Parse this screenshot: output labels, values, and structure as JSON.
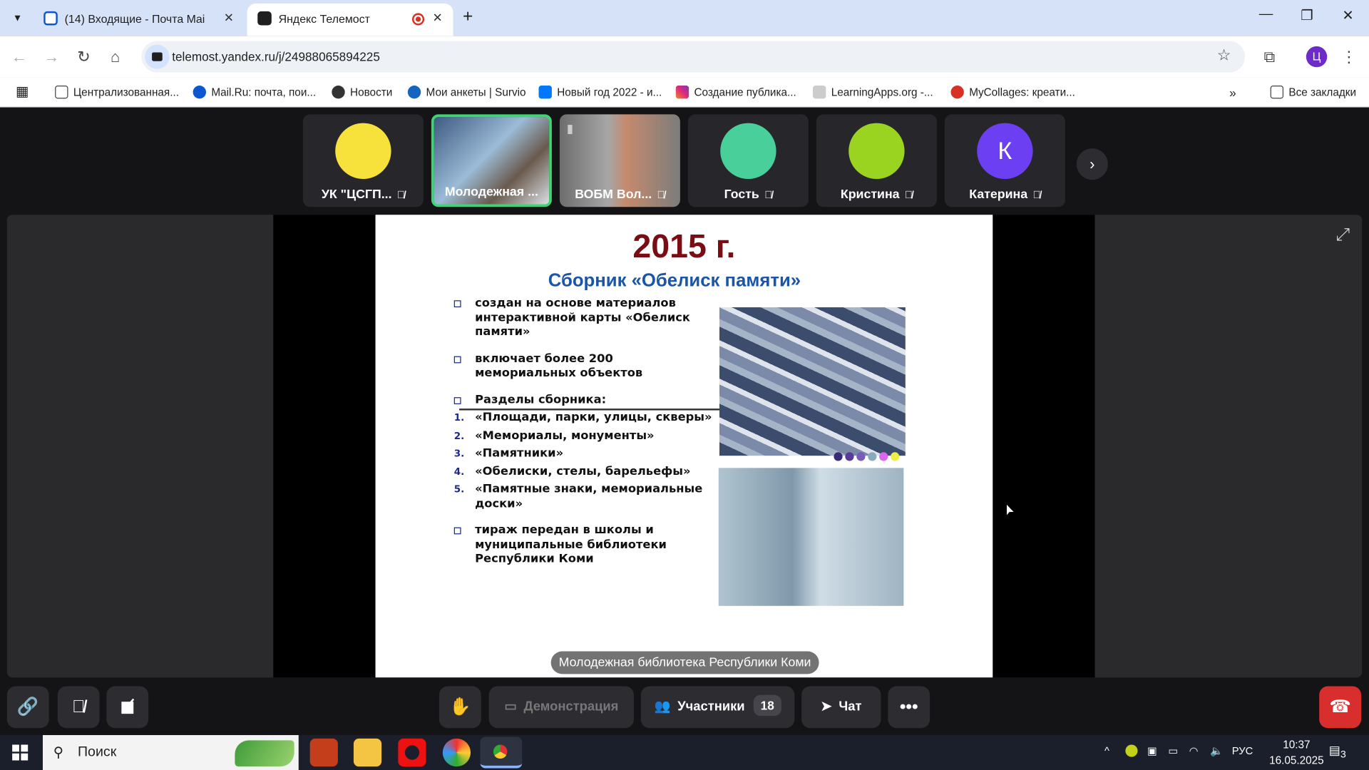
{
  "browser": {
    "tabs": [
      {
        "title": "(14) Входящие - Почта Mail",
        "icon": "mail-icon"
      },
      {
        "title": "Яндекс Телемост",
        "icon": "telemost-icon",
        "recording": true
      }
    ],
    "url": "telemost.yandex.ru/j/24988065894225",
    "profile_initial": "Ц",
    "bookmarks": [
      "Централизованная...",
      "Mail.Ru: почта, пои...",
      "Новости",
      "Мои анкеты | Survio",
      "Новый год 2022 - и...",
      "Создание публика...",
      "LearningApps.org -...",
      "MyCollages: креати..."
    ],
    "all_bookmarks": "Все закладки"
  },
  "participants": [
    {
      "name": "УК \"ЦСГП...",
      "color": "#f6e23a",
      "type": "avatar"
    },
    {
      "name": "Молодежная ...",
      "type": "video",
      "active": true
    },
    {
      "name": "ВОБМ Вол...",
      "type": "video"
    },
    {
      "name": "Гость",
      "color": "#49cf9a",
      "type": "avatar"
    },
    {
      "name": "Кристина",
      "color": "#9bd321",
      "type": "avatar"
    },
    {
      "name": "Катерина",
      "color": "#6c3ff2",
      "type": "avatar",
      "initial": "К"
    }
  ],
  "slide": {
    "year": "2015 г.",
    "subtitle": "Сборник «Обелиск памяти»",
    "point1": "создан на основе материалов интерактивной карты «Обелиск памяти»",
    "point2": "включает более 200 мемориальных объектов",
    "point3": "Разделы сборника:",
    "sections": [
      "«Площади, парки, улицы, скверы»",
      "«Мемориалы, монументы»",
      "«Памятники»",
      "«Обелиски, стелы, барельефы»",
      "«Памятные знаки, мемориальные доски»"
    ],
    "point4": "тираж передан в школы и муниципальные библиотеки Республики Коми"
  },
  "presenter_caption": "Молодежная библиотека Республики Коми",
  "controls": {
    "demonstration": "Демонстрация",
    "participants": "Участники",
    "participants_count": "18",
    "chat": "Чат"
  },
  "taskbar": {
    "search": "Поиск",
    "lang": "РУС",
    "time": "10:37",
    "date": "16.05.2025",
    "notifications": "3"
  }
}
